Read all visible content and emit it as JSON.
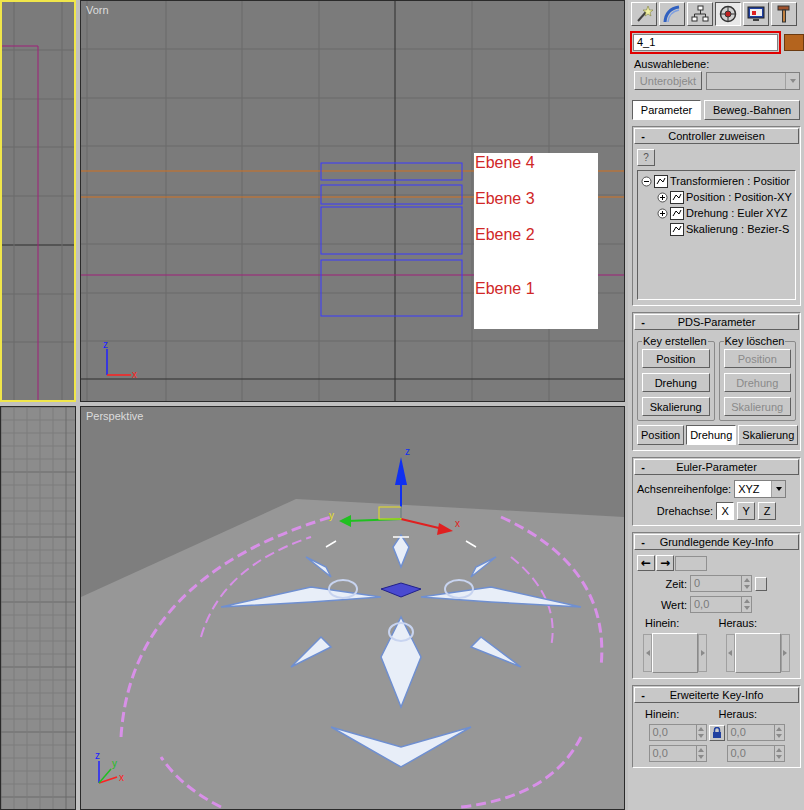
{
  "viewports": {
    "top_left": {
      "active": true
    },
    "front": {
      "label": "Vorn",
      "active": false,
      "layers": [
        "Ebene 4",
        "Ebene 3",
        "Ebene 2",
        "Ebene 1"
      ],
      "axes": [
        "z",
        "x"
      ]
    },
    "bottom_left": {
      "active": false
    },
    "perspective": {
      "label": "Perspektive",
      "active": false,
      "gizmo_axes": [
        "z",
        "y",
        "x"
      ],
      "axes": [
        "z",
        "x",
        "y"
      ]
    }
  },
  "command_panel": {
    "tabs": [
      {
        "kind": "create",
        "selected": false
      },
      {
        "kind": "modify",
        "selected": false
      },
      {
        "kind": "hierarchy",
        "selected": false
      },
      {
        "kind": "motion",
        "selected": true
      },
      {
        "kind": "display",
        "selected": false
      },
      {
        "kind": "utilities",
        "selected": false
      }
    ],
    "object_name": {
      "value": "4_1",
      "highlighted": true,
      "swatch_color": "#b4641e"
    },
    "selection_level": {
      "label": "Auswahlebene:",
      "button": "Unterobjekt",
      "disabled": true
    },
    "sub_tabs": [
      {
        "label": "Parameter",
        "selected": true
      },
      {
        "label": "Beweg.-Bahnen",
        "selected": false
      }
    ],
    "assign_controller": {
      "title": "Controller zuweisen",
      "collapse": "-",
      "help": "?",
      "tree": [
        {
          "label": "Transformieren : Positior",
          "depth": 0,
          "expander": "minus"
        },
        {
          "label": "Position : Position-XY",
          "depth": 1,
          "expander": "plus"
        },
        {
          "label": "Drehung : Euler XYZ",
          "depth": 1,
          "expander": "plus"
        },
        {
          "label": "Skalierung : Bezier-S",
          "depth": 1,
          "expander": "none"
        }
      ]
    },
    "pds": {
      "title": "PDS-Parameter",
      "collapse": "-",
      "create": {
        "label": "Key erstellen",
        "buttons": [
          {
            "label": "Position",
            "disabled": false
          },
          {
            "label": "Drehung",
            "disabled": false
          },
          {
            "label": "Skalierung",
            "disabled": false
          }
        ]
      },
      "delete": {
        "label": "Key löschen",
        "buttons": [
          {
            "label": "Position",
            "disabled": true
          },
          {
            "label": "Drehung",
            "disabled": true
          },
          {
            "label": "Skalierung",
            "disabled": true
          }
        ]
      },
      "tabs": [
        {
          "label": "Position",
          "selected": false
        },
        {
          "label": "Drehung",
          "selected": true
        },
        {
          "label": "Skalierung",
          "selected": false
        }
      ]
    },
    "euler": {
      "title": "Euler-Parameter",
      "collapse": "-",
      "order_label": "Achsenreihenfolge:",
      "order_value": "XYZ",
      "axis_label": "Drehachse:",
      "axes": [
        {
          "label": "X",
          "selected": true
        },
        {
          "label": "Y",
          "selected": false
        },
        {
          "label": "Z",
          "selected": false
        }
      ]
    },
    "key_info": {
      "title": "Grundlegende Key-Info",
      "collapse": "-",
      "prev": "←",
      "next": "→",
      "key_number": "",
      "time_label": "Zeit:",
      "time": "0",
      "value_label": "Wert:",
      "value": "0,0",
      "in_label": "Hinein:",
      "out_label": "Heraus:",
      "disabled": true
    },
    "advanced_key_info": {
      "title": "Erweiterte Key-Info",
      "collapse": "-",
      "in_label": "Hinein:",
      "out_label": "Heraus:",
      "rows": [
        [
          "0,0",
          "0,0"
        ],
        [
          "0,0",
          "0,0"
        ]
      ],
      "locked": false,
      "disabled": true
    }
  }
}
